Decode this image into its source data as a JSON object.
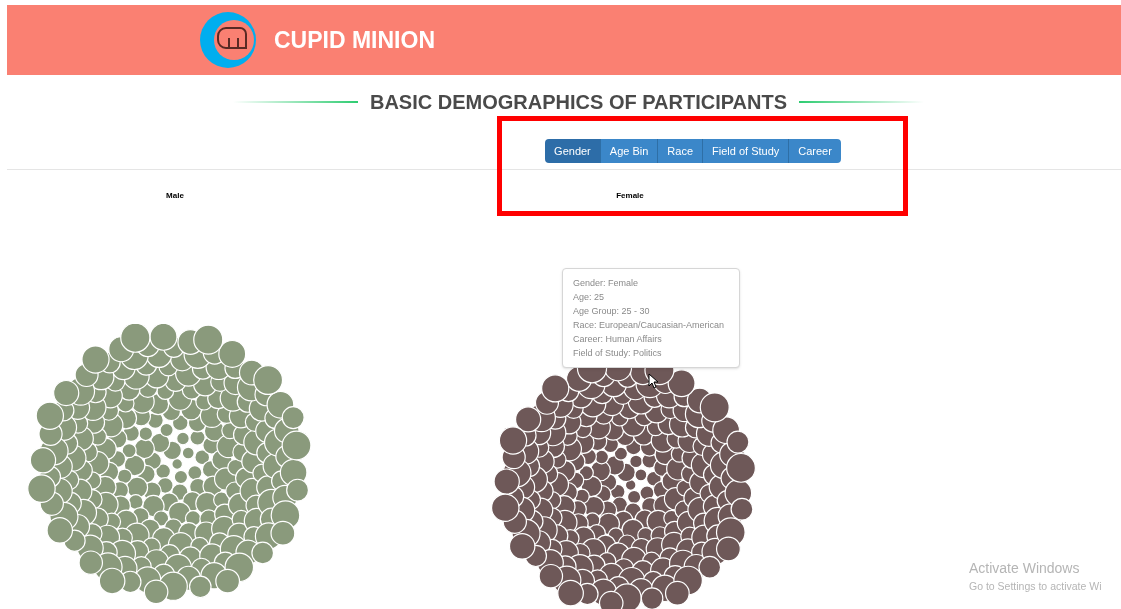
{
  "header": {
    "brand": "CUPID MINION"
  },
  "title": "BASIC DEMOGRAPHICS OF PARTICIPANTS",
  "filters": [
    {
      "label": "Gender",
      "selected": true
    },
    {
      "label": "Age Bin",
      "selected": false
    },
    {
      "label": "Race",
      "selected": false
    },
    {
      "label": "Field of Study",
      "selected": false
    },
    {
      "label": "Career",
      "selected": false
    }
  ],
  "groups": [
    {
      "label": "Male",
      "color": "#8a9a7c"
    },
    {
      "label": "Female",
      "color": "#6e5858"
    }
  ],
  "tooltip": {
    "lines": [
      "Gender: Female",
      "Age: 25",
      "Age Group: 25 - 30",
      "Race: European/Caucasian-American",
      "Career: Human Affairs",
      "Field of Study: Politics"
    ]
  },
  "annotation": {
    "kind": "highlight"
  },
  "os_notice": {
    "title": "Activate Windows",
    "text": "Go to Settings to activate Wi"
  }
}
